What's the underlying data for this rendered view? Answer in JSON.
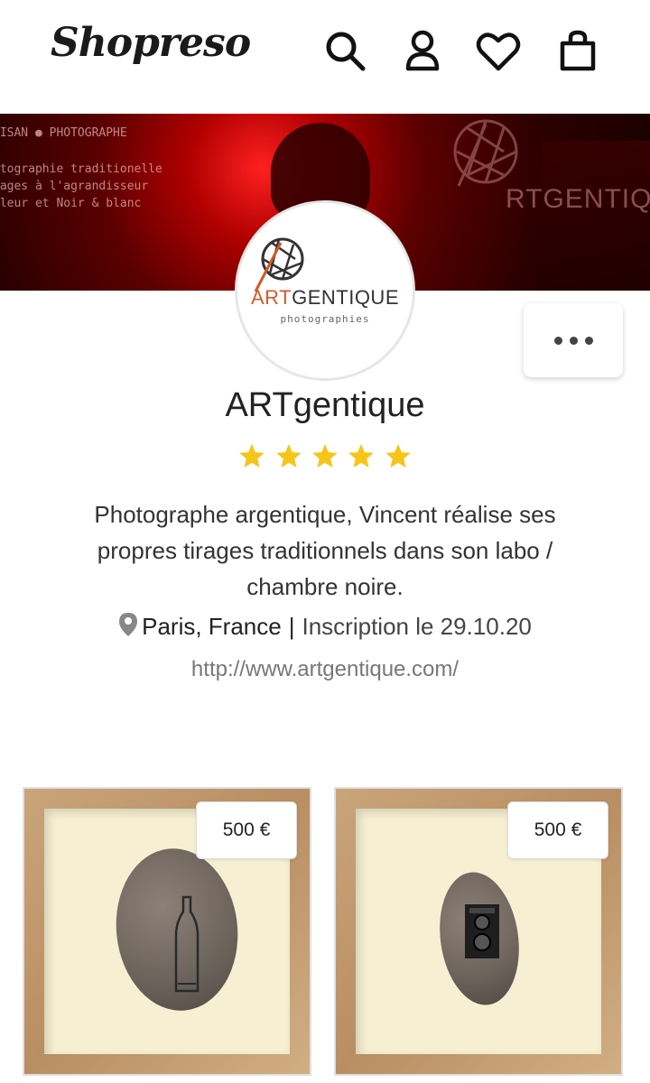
{
  "header": {
    "logo": "Shopreso",
    "icons": [
      "search-icon",
      "user-icon",
      "heart-icon",
      "bag-icon"
    ]
  },
  "banner": {
    "line1": "TISAN ● PHOTOGRAPHE",
    "line2": "otographie traditionelle",
    "line3": "rages à l'agrandisseur",
    "line4": "aleur et Noir & blanc",
    "brand": "RTGENTIQUE"
  },
  "avatar": {
    "brand_a": "ART",
    "brand_b": "GENTIQUE",
    "sub": "photographies"
  },
  "shop": {
    "name": "ARTgentique",
    "rating": 5,
    "description": "Photographe argentique, Vincent réalise ses propres tirages traditionnels dans son labo / chambre noire.",
    "location": "Paris, France",
    "separator": "|",
    "joined": "Inscription le 29.10.20",
    "website": "http://www.artgentique.com/"
  },
  "colors": {
    "star": "#f5c518",
    "accent_orange": "#d05a2a"
  },
  "products": [
    {
      "price": "500 €"
    },
    {
      "price": "500 €"
    }
  ]
}
